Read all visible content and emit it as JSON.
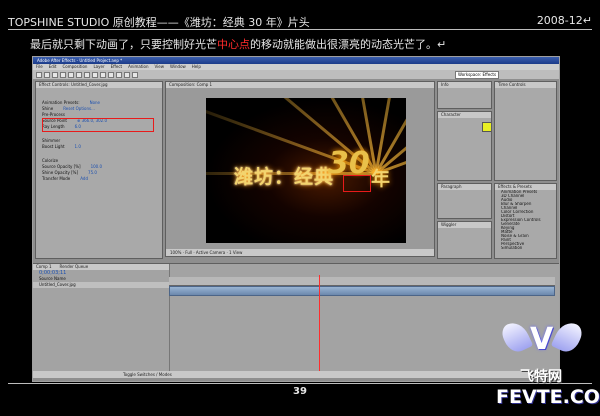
{
  "header": {
    "title": "TOPSHINE STUDIO 原创教程——《潍坊：经典 30 年》片头",
    "date": "2008-12↵"
  },
  "intro": {
    "before": "最后就只剩下动画了，只要控制好光芒",
    "highlight": "中心点",
    "after": "的移动就能做出很漂亮的动态光芒了。↵",
    "highlight_color": "#ff2b2b"
  },
  "app": {
    "title": "Adobe After Effects - Untitled Project.aep *",
    "menus": [
      "File",
      "Edit",
      "Composition",
      "Layer",
      "Effect",
      "Animation",
      "View",
      "Window",
      "Help"
    ],
    "workspace": "Workspace: Effects",
    "effect_panel": {
      "tab": "Effect Controls: Untitled_Cover.jpg",
      "rows": [
        {
          "label": "Animation Presets:",
          "value": "None"
        },
        {
          "label": "Shine",
          "value": "Reset  Options..."
        },
        {
          "label": "Pre-Process",
          "value": ""
        },
        {
          "label": "Source Point",
          "value": "⊕ 366.0, 302.0"
        },
        {
          "label": "Ray Length",
          "value": "6.0"
        },
        {
          "label": "Shimmer",
          "value": ""
        },
        {
          "label": "Boost Light",
          "value": "1.0"
        },
        {
          "label": "Colorize",
          "value": ""
        },
        {
          "label": "Source Opacity [%]",
          "value": "100.0"
        },
        {
          "label": "Shine Opacity [%]",
          "value": "75.0"
        },
        {
          "label": "Transfer Mode",
          "value": "Add"
        }
      ]
    },
    "viewer": {
      "tab": "Composition: Comp 1",
      "footer": "100%  ·  Full  ·  Active Camera  ·  1 View",
      "text_main": "潍坊：经典",
      "text_num": "30",
      "text_nian": "年"
    },
    "right_panels": {
      "info_tab": "Info",
      "character_tab": "Character",
      "paragraph_tab": "Paragraph",
      "wiggler_tab": "Wiggler",
      "preview_tab": "Time Controls",
      "effects_tab": "Effects & Presets",
      "effects_items": [
        "Animation Presets",
        "3D Channel",
        "Audio",
        "Blur & Sharpen",
        "Channel",
        "Color Correction",
        "Distort",
        "Expression Controls",
        "Generate",
        "Keying",
        "Matte",
        "Noise & Grain",
        "Paint",
        "Perspective",
        "Simulation"
      ]
    },
    "timeline": {
      "tabs": [
        "Comp 1",
        "Render Queue"
      ],
      "timecode": "0;00;03;11",
      "layer": "Source Name",
      "layer_file": "Untitled_Cover.jpg",
      "footer": "Toggle Switches / Modes"
    }
  },
  "page_number": "39",
  "logo": {
    "letter": "V",
    "cn": "飞特网",
    "en": "FEVTE.COM"
  }
}
